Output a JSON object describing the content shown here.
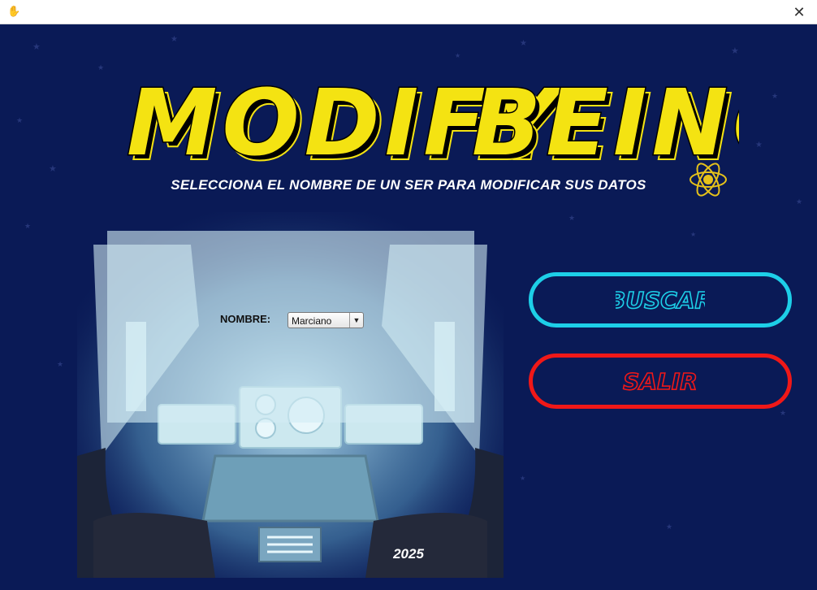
{
  "window": {
    "app_icon": "hand-icon",
    "close_glyph": "✕"
  },
  "header": {
    "title_left": "MODIFY",
    "title_right": "BEING",
    "subtitle": "SELECCIONA EL NOMBRE DE UN SER PARA MODIFICAR SUS DATOS"
  },
  "form": {
    "name_label": "NOMBRE:",
    "name_select": {
      "selected": "Marciano",
      "arrow": "▼"
    }
  },
  "buttons": {
    "search": "BUSCAR",
    "exit": "SALIR"
  },
  "footer": {
    "year": "2025"
  },
  "colors": {
    "background": "#0a1a56",
    "title_yellow": "#f4e312",
    "search_accent": "#1dcfe8",
    "exit_accent": "#f01818"
  }
}
